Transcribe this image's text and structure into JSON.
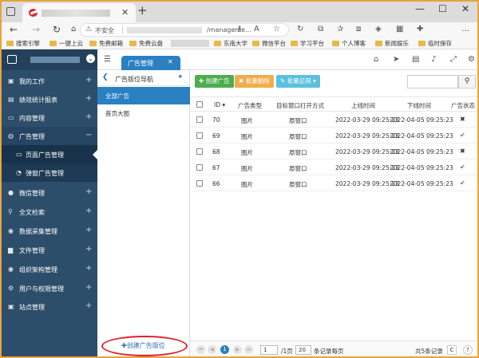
{
  "browser": {
    "address": {
      "security_label": "不安全",
      "url": "/manageme..."
    },
    "bookmarks": [
      "搜索引擎",
      "一键上云",
      "免费邮箱",
      "免费云盘",
      "东南大学",
      "微信平台",
      "学习平台",
      "个人博客",
      "新闻娱乐",
      "临时保存"
    ]
  },
  "app": {
    "tab_label": "广告管理",
    "sidebar": [
      {
        "label": "我的工作",
        "icon": "desktop-icon",
        "glyph": "▣"
      },
      {
        "label": "绩效统计报表",
        "icon": "chart-icon",
        "glyph": "▤"
      },
      {
        "label": "内容管理",
        "icon": "file-icon",
        "glyph": "▭"
      },
      {
        "label": "广告管理",
        "icon": "ad-icon",
        "glyph": "◍",
        "open": true
      },
      {
        "label": "微信管理",
        "icon": "wechat-icon",
        "glyph": "●"
      },
      {
        "label": "全文检索",
        "icon": "search-icon",
        "glyph": "⚲"
      },
      {
        "label": "数据采集管理",
        "icon": "database-icon",
        "glyph": "◉"
      },
      {
        "label": "文件管理",
        "icon": "folder-icon",
        "glyph": "▆"
      },
      {
        "label": "组织架构管理",
        "icon": "org-icon",
        "glyph": "◉"
      },
      {
        "label": "用户与权限管理",
        "icon": "users-icon",
        "glyph": "⚙"
      },
      {
        "label": "站点管理",
        "icon": "site-icon",
        "glyph": "▣"
      }
    ],
    "sidebar_sub": [
      {
        "label": "页面广告管理",
        "glyph": "▭",
        "active": true
      },
      {
        "label": "弹窗广告管理",
        "glyph": "◔"
      }
    ],
    "nav_panel": {
      "title": "广告版位导航",
      "items": [
        "全部广告",
        "首页大图"
      ],
      "create_label": "✚创建广告版位"
    },
    "toolbar": {
      "create": "✚ 创建广告",
      "batch_delete": "✖ 批量删除",
      "batch_enable": "✎ 批量启用 ▾"
    },
    "grid": {
      "columns": [
        "ID ▾",
        "广告类型",
        "目标窗口打开方式",
        "上线时间",
        "下线时间",
        "广告状态"
      ],
      "rows": [
        {
          "id": "70",
          "type": "图片",
          "target": "原窗口",
          "online": "2022-03-29 09:25:23",
          "offline": "2022-04-05 09:25:23",
          "status": "✖",
          "status_kind": "x"
        },
        {
          "id": "69",
          "type": "图片",
          "target": "原窗口",
          "online": "2022-03-29 09:25:23",
          "offline": "2022-04-05 09:25:23",
          "status": "✔",
          "status_kind": "ok"
        },
        {
          "id": "68",
          "type": "图片",
          "target": "原窗口",
          "online": "2022-03-29 09:25:23",
          "offline": "2022-04-05 09:25:23",
          "status": "✖",
          "status_kind": "x"
        },
        {
          "id": "67",
          "type": "图片",
          "target": "原窗口",
          "online": "2022-03-29 09:25:23",
          "offline": "2022-04-05 09:25:23",
          "status": "✔",
          "status_kind": "ok"
        },
        {
          "id": "66",
          "type": "图片",
          "target": "原窗口",
          "online": "2022-03-29 09:25:23",
          "offline": "2022-04-05 09:25:23",
          "status": "✔",
          "status_kind": "ok"
        }
      ]
    },
    "pager": {
      "current_page": "1",
      "page_input": "1",
      "total_pages_label": "/1页",
      "page_size": "20",
      "per_page_label": "条记录每页",
      "total_label": "共5条记录",
      "refresh": "C",
      "help": "?"
    }
  }
}
